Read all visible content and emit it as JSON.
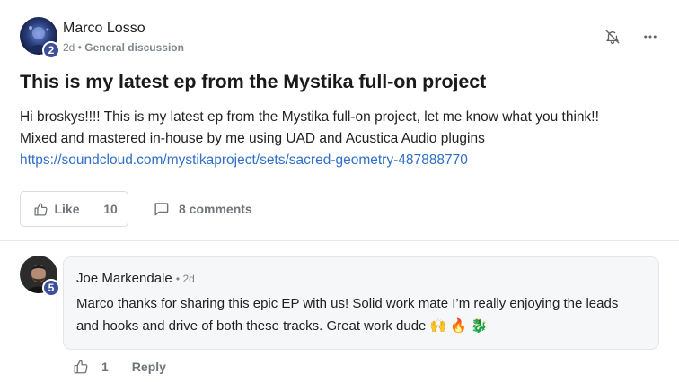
{
  "post": {
    "author": {
      "name": "Marco Losso",
      "level": "2"
    },
    "meta": {
      "time": "2d",
      "separator": "•",
      "category": "General discussion"
    },
    "title": "This is my latest ep from the Mystika full-on project",
    "body_lines": [
      "Hi broskys!!!! This is my latest ep from the Mystika full-on project, let me know what you think!!",
      "Mixed and mastered in-house by me using UAD and Acustica Audio plugins"
    ],
    "link": "https://soundcloud.com/mystikaproject/sets/sacred-geometry-487888770",
    "like_label": "Like",
    "like_count": "10",
    "comments_label": "8 comments"
  },
  "comment": {
    "author": {
      "name": "Joe Markendale",
      "level": "5"
    },
    "time": "• 2d",
    "text": "Marco thanks for sharing this epic EP with us! Solid work mate I’m really enjoying the leads and hooks and drive of both these tracks. Great work dude 🙌 🔥 🐉",
    "like_count": "1",
    "reply_label": "Reply"
  },
  "icons": {
    "notification": "bell-off-icon",
    "more": "more-horizontal-icon",
    "like": "thumbs-up-icon",
    "comments": "comment-bubble-icon"
  },
  "colors": {
    "link": "#2f6fc9",
    "badge": "#3b4f9a",
    "muted": "#70757a"
  }
}
